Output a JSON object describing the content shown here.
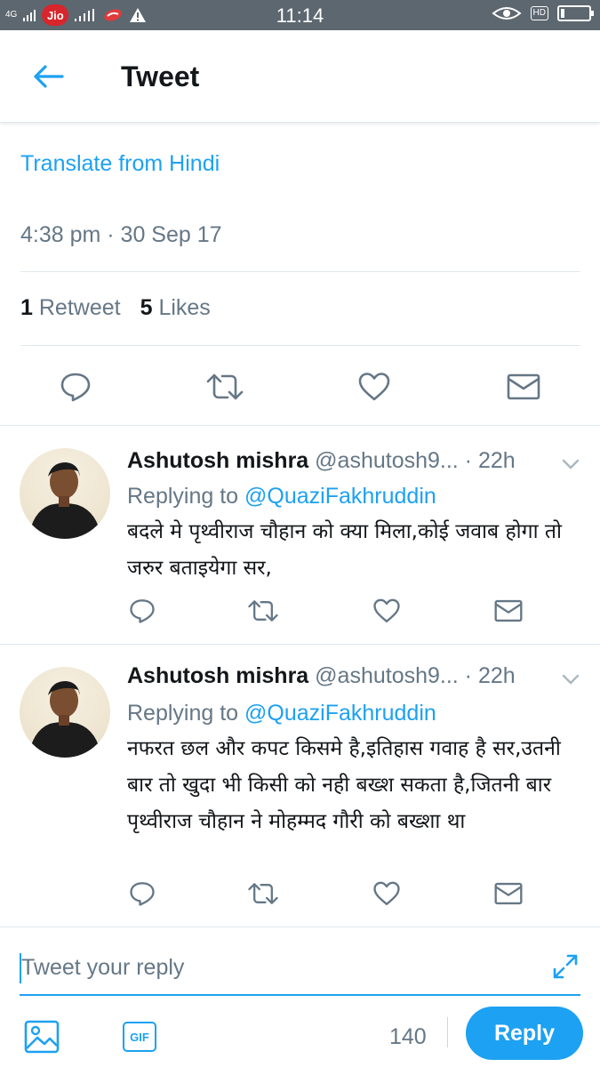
{
  "status_bar": {
    "network": "4G",
    "carrier_badge": "Jio",
    "time": "11:14",
    "hd": "HD",
    "battery_level": 0.12
  },
  "header": {
    "title": "Tweet",
    "back_icon": "arrow-left-icon"
  },
  "tweet": {
    "translate_link": "Translate from Hindi",
    "timestamp": "4:38 pm · 30 Sep 17",
    "retweet_count": "1",
    "retweet_label": "Retweet",
    "like_count": "5",
    "like_label": "Likes",
    "actions": [
      "reply-icon",
      "retweet-icon",
      "heart-icon",
      "mail-icon"
    ]
  },
  "replies": [
    {
      "name": "Ashutosh mishra",
      "handle_time": "@ashutosh9... · 22h",
      "replying_prefix": "Replying to",
      "replying_to": "@QuaziFakhruddin",
      "text": "बदले मे पृथ्वीराज चौहान को क्या मिला,कोई जवाब होगा तो जरुर बताइयेगा सर,"
    },
    {
      "name": "Ashutosh mishra",
      "handle_time": "@ashutosh9... · 22h",
      "replying_prefix": "Replying to",
      "replying_to": "@QuaziFakhruddin",
      "text": "नफरत छल और कपट किसमे है,इतिहास गवाह है सर,उतनी बार तो खुदा भी किसी को नही बख्श सकता है,जितनी बार पृथ्वीराज चौहान ने मोहम्मद गौरी को बख्शा था"
    }
  ],
  "composer": {
    "placeholder": "Tweet your reply",
    "char_count": "140",
    "reply_button": "Reply",
    "gif_label": "GIF"
  },
  "colors": {
    "accent": "#1da1f2",
    "secondary_text": "#657786",
    "divider": "#e1e8ed",
    "status_bar": "#5d6770"
  }
}
